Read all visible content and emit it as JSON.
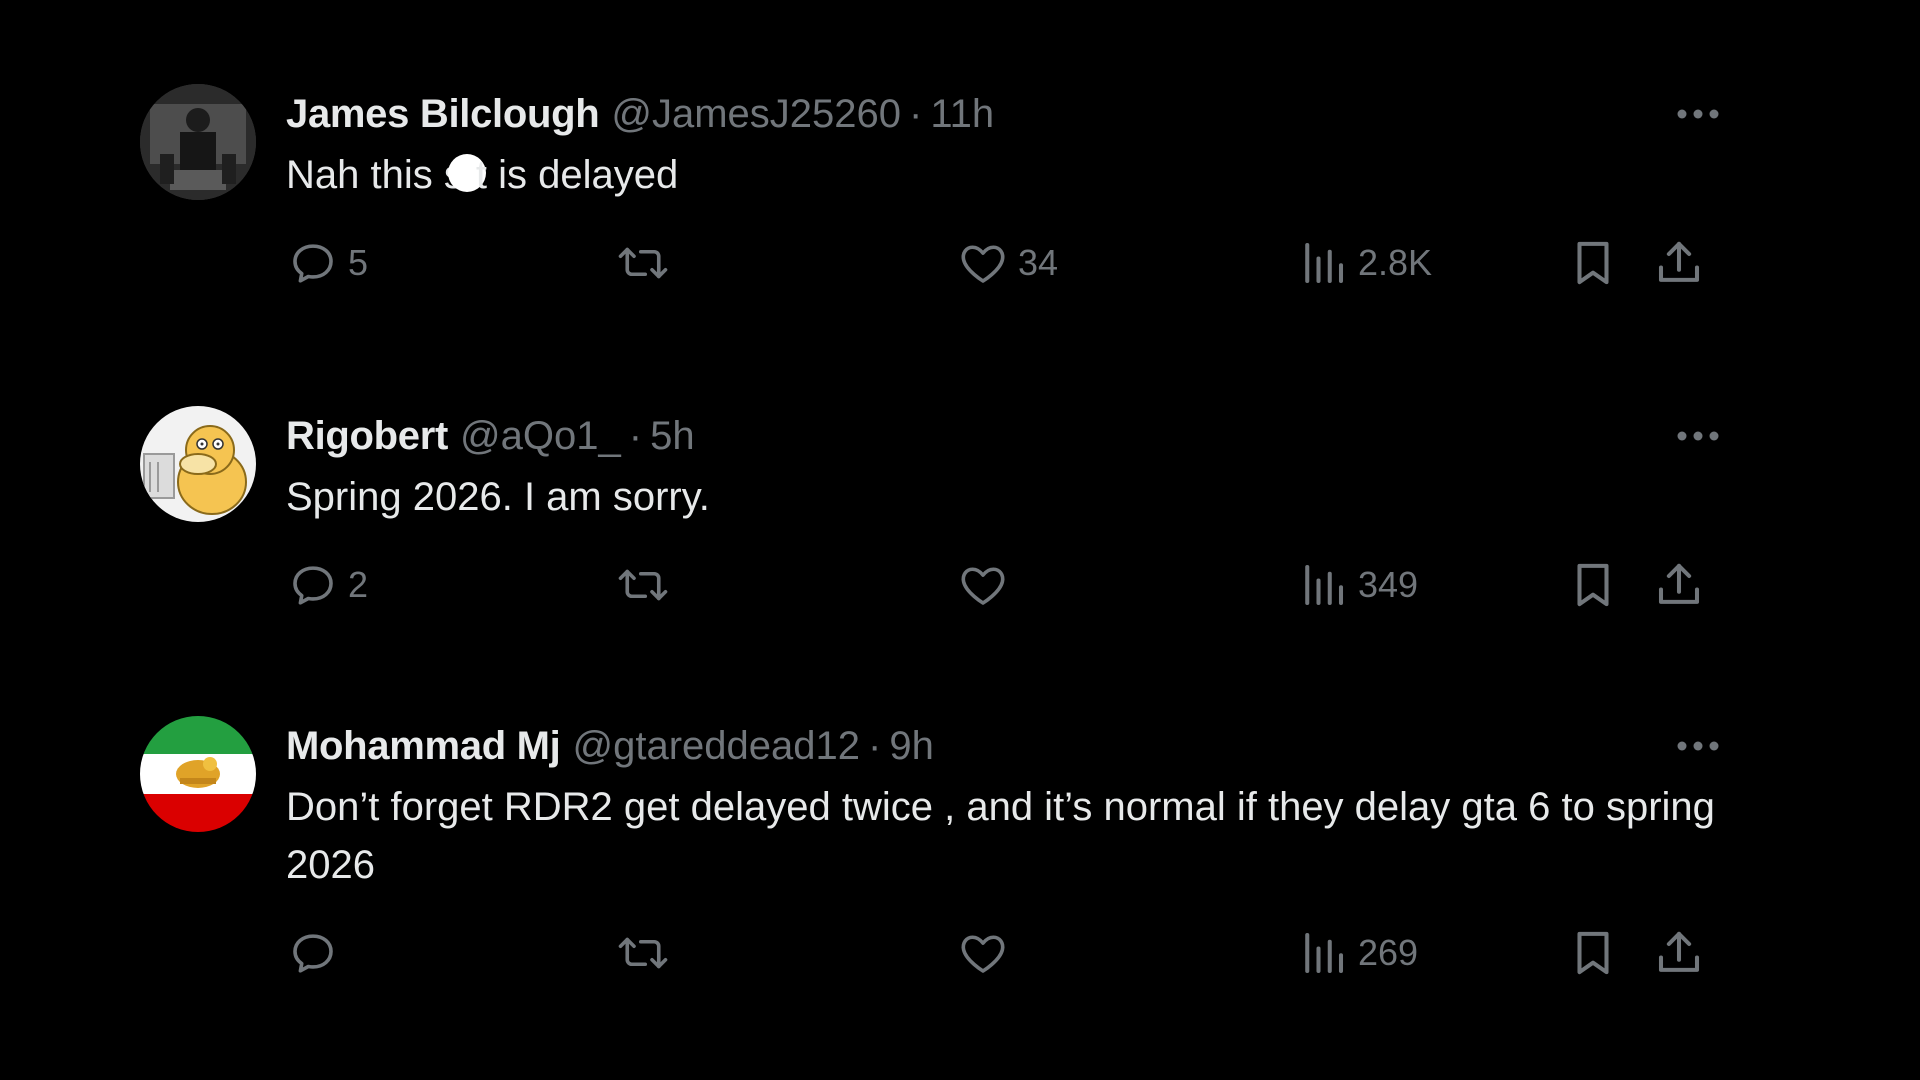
{
  "colors": {
    "background": "#000000",
    "primary_text": "#e7e9ea",
    "secondary_text": "#71767b"
  },
  "tweets": [
    {
      "display_name": "James Bilclough",
      "handle": "@JamesJ25260",
      "separator": "·",
      "time": "11h",
      "text_before": "Nah this s",
      "text_after": "t is delayed",
      "reply_count": "5",
      "retweet_count": "",
      "like_count": "34",
      "view_count": "2.8K"
    },
    {
      "display_name": "Rigobert",
      "handle": "@aQo1_",
      "separator": "·",
      "time": "5h",
      "text": "Spring 2026. I am sorry.",
      "reply_count": "2",
      "retweet_count": "",
      "like_count": "",
      "view_count": "349"
    },
    {
      "display_name": "Mohammad Mj",
      "handle": "@gtareddead12",
      "separator": "·",
      "time": "9h",
      "text": "Don’t forget RDR2 get delayed twice , and it’s normal if they delay gta 6 to spring 2026",
      "reply_count": "",
      "retweet_count": "",
      "like_count": "",
      "view_count": "269"
    }
  ],
  "icons": {
    "more": "more-horizontal-icon",
    "reply": "reply-bubble-icon",
    "retweet": "retweet-icon",
    "like": "heart-icon",
    "views": "views-bar-chart-icon",
    "bookmark": "bookmark-icon",
    "share": "share-upload-icon"
  }
}
